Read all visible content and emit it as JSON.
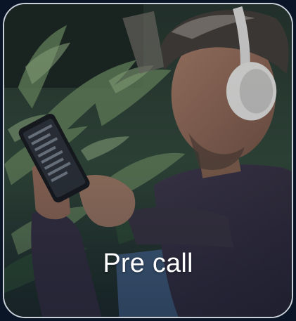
{
  "card": {
    "caption": "Pre call",
    "image_subject": "man-with-headphones-using-phone"
  },
  "colors": {
    "page_background": "#0a1628",
    "card_border": "#c9d0d8",
    "caption_text": "#ffffff"
  }
}
